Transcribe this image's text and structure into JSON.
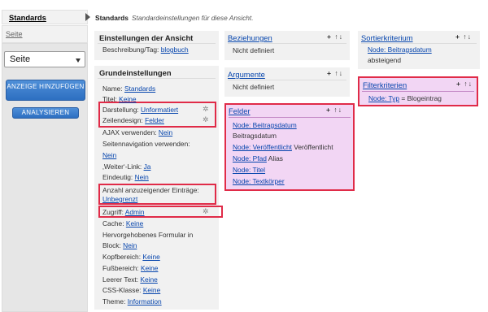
{
  "left": {
    "standards_label": "Standards",
    "seite_label": "Seite",
    "select_value": "Seite",
    "btn_add": "ANZEIGE HINZUFÜGEN",
    "btn_analyze": "ANALYSIEREN"
  },
  "header": {
    "title": "Standards",
    "subtitle": "Standardeinstellungen für diese Ansicht."
  },
  "einstellungen": {
    "title": "Einstellungen der Ansicht",
    "beschreibung_label": "Beschreibung/Tag:",
    "beschreibung_value": "blogbuch"
  },
  "grund": {
    "title": "Grundeinstellungen",
    "name_label": "Name:",
    "name_value": "Standards",
    "titel_label": "Titel:",
    "titel_value": "Keine",
    "darstellung_label": "Darstellung:",
    "darstellung_value": "Unformatiert",
    "zeilendesign_label": "Zeilendesign:",
    "zeilendesign_value": "Felder",
    "ajax_label": "AJAX verwenden:",
    "ajax_value": "Nein",
    "seitennav_label": "Seitennavigation verwenden:",
    "seitennav_value": "Nein",
    "anzahl_label": "Anzahl anzuzeigender Einträge:",
    "anzahl_value": "Unbegrenzt",
    "weiter_label": "‚Weiter‘-Link:",
    "weiter_value": "Ja",
    "eindeutig_label": "Eindeutig:",
    "eindeutig_value": "Nein",
    "zugriff_label": "Zugriff:",
    "zugriff_value": "Admin",
    "cache_label": "Cache:",
    "cache_value": "Keine",
    "hervor_label_1": "Hervorgehobenes Formular in",
    "hervor_label_2": "Block:",
    "hervor_value": "Nein",
    "kopf_label": "Kopfbereich:",
    "kopf_value": "Keine",
    "fuss_label": "Fußbereich:",
    "fuss_value": "Keine",
    "leer_label": "Leerer Text:",
    "leer_value": "Keine",
    "css_label": "CSS-Klasse:",
    "css_value": "Keine",
    "theme_label": "Theme:",
    "theme_value": "Information"
  },
  "beziehungen": {
    "title": "Beziehungen",
    "body": "Nicht definiert"
  },
  "argumente": {
    "title": "Argumente",
    "body": "Nicht definiert"
  },
  "felder": {
    "title": "Felder",
    "rows": [
      {
        "link": "Node: Beitragsdatum",
        "text": ""
      },
      {
        "link": "",
        "text": "Beitragsdatum"
      },
      {
        "link": "Node: Veröffentlicht",
        "text": " Veröffentlicht"
      },
      {
        "link": "Node: Pfad",
        "text": " Alias"
      },
      {
        "link": "Node: Titel",
        "text": ""
      },
      {
        "link": "Node: Textkörper",
        "text": ""
      }
    ]
  },
  "sortier": {
    "title": "Sortierkriterium",
    "link": "Node: Beitragsdatum",
    "text": "absteigend"
  },
  "filter": {
    "title": "Filterkriterien",
    "link": "Node: Typ",
    "text": " = Blogeintrag"
  },
  "controls": {
    "plus": "+",
    "sort": "↑↓"
  },
  "icons": {
    "gear": "gear-icon",
    "add": "plus-icon",
    "rearrange": "sort-icon"
  },
  "colors": {
    "highlight_red": "#e02b48",
    "highlight_pink": "#f0c9f0",
    "button_blue": "#2d6fc1",
    "link": "#0645ad"
  }
}
